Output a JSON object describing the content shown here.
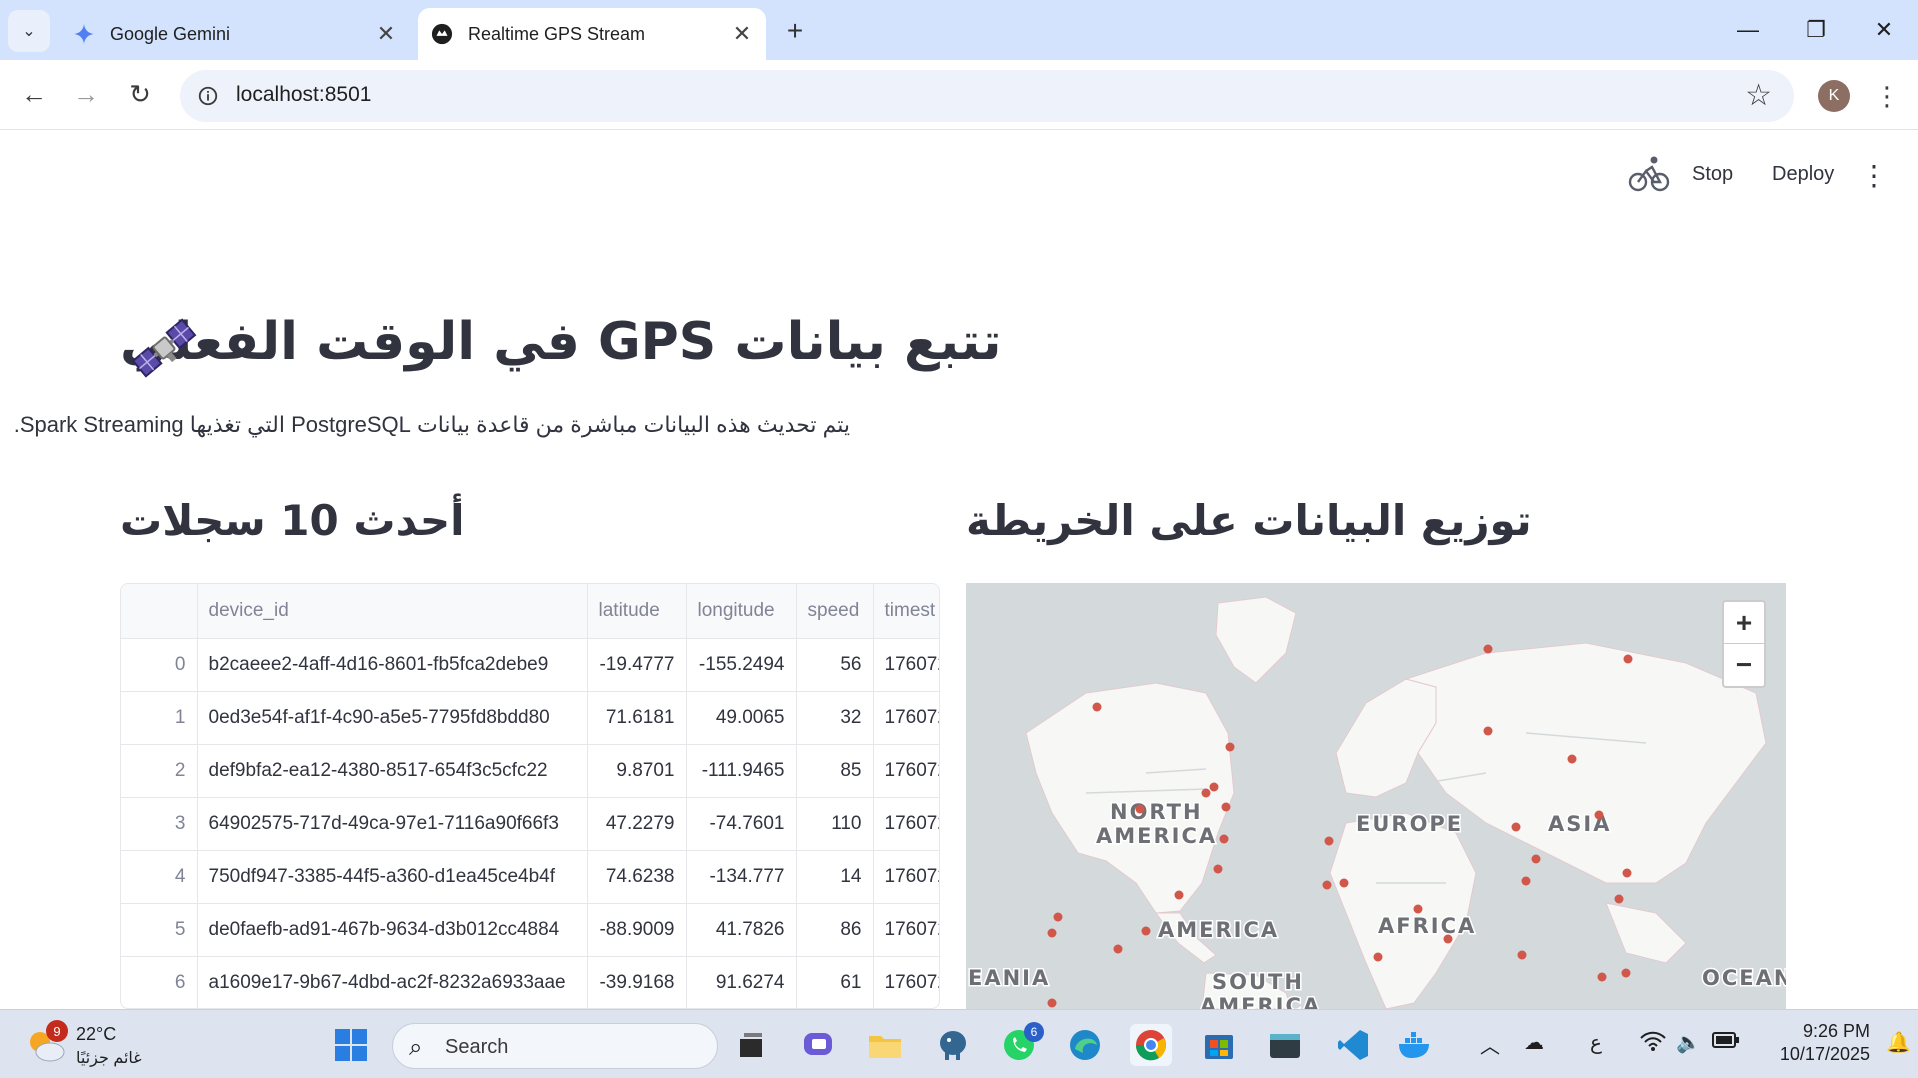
{
  "browser": {
    "tabs": [
      {
        "title": "Google Gemini"
      },
      {
        "title": "Realtime GPS Stream"
      }
    ],
    "url": "localhost:8501",
    "profile_initial": "K"
  },
  "streamlit": {
    "stop_label": "Stop",
    "deploy_label": "Deploy"
  },
  "page": {
    "title": "تتبع بيانات GPS في الوقت الفعلي",
    "title_emoji": "satellite",
    "subtitle": "يتم تحديث هذه البيانات مباشرة من قاعدة بيانات PostgreSQL التي تغذيها Spark Streaming.",
    "table_heading": "أحدث 10 سجلات",
    "map_heading": "توزيع البيانات على الخريطة"
  },
  "table": {
    "columns": [
      "",
      "device_id",
      "latitude",
      "longitude",
      "speed",
      "timest"
    ],
    "rows": [
      [
        "0",
        "b2caeee2-4aff-4d16-8601-fb5fca2debe9",
        "-19.4777",
        "-155.2494",
        "56",
        "176072"
      ],
      [
        "1",
        "0ed3e54f-af1f-4c90-a5e5-7795fd8bdd80",
        "71.6181",
        "49.0065",
        "32",
        "176072"
      ],
      [
        "2",
        "def9bfa2-ea12-4380-8517-654f3c5cfc22",
        "9.8701",
        "-111.9465",
        "85",
        "176072"
      ],
      [
        "3",
        "64902575-717d-49ca-97e1-7116a90f66f3",
        "47.2279",
        "-74.7601",
        "110",
        "176072"
      ],
      [
        "4",
        "750df947-3385-44f5-a360-d1ea45ce4b4f",
        "74.6238",
        "-134.777",
        "14",
        "176072"
      ],
      [
        "5",
        "de0faefb-ad91-467b-9634-d3b012cc4884",
        "-88.9009",
        "41.7826",
        "86",
        "176072"
      ],
      [
        "6",
        "a1609e17-9b67-4dbd-ac2f-8232a6933aae",
        "-39.9168",
        "91.6274",
        "61",
        "176072"
      ]
    ]
  },
  "map": {
    "labels": [
      "NORTH",
      "AMERICA",
      "EUROPE",
      "ASIA",
      "AMERICA",
      "AFRICA",
      "EANIA",
      "SOUTH",
      "OCEAN",
      "AMERICA"
    ],
    "zoom_in": "+",
    "zoom_out": "−",
    "marker_color": "#d0574a"
  },
  "taskbar": {
    "weather_temp": "22°C",
    "weather_cond": "غائم جزئيًا",
    "weather_badge": "9",
    "search_placeholder": "Search",
    "whatsapp_badge": "6",
    "lang": "ع",
    "time": "9:26 PM",
    "date": "10/17/2025"
  }
}
